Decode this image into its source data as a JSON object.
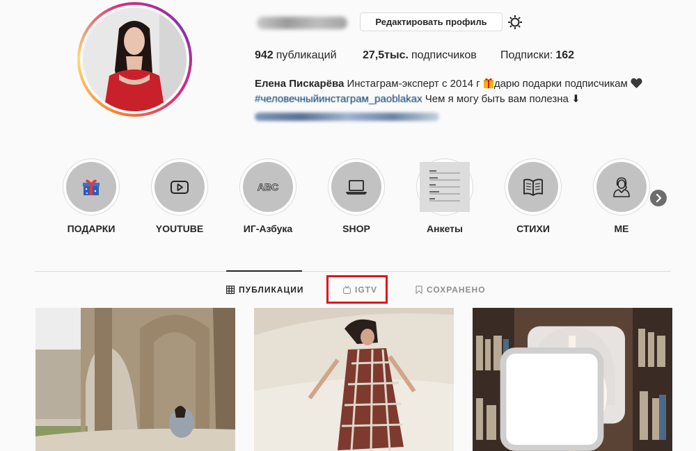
{
  "profile": {
    "edit_button": "Редактировать профиль",
    "stats": {
      "posts_count": "942",
      "posts_label": "публикаций",
      "followers_count": "27,5тыс.",
      "followers_label": "подписчиков",
      "following_label": "Подписки:",
      "following_count": "162"
    },
    "bio": {
      "name": "Елена Пискарёва",
      "text_1": " Инстаграм-эксперт с 2014 г ",
      "text_2": "дарю подарки подписчикам ",
      "hashtags": "#человечныйинстаграм_paoblakax",
      "text_3": " Чем я могу быть вам полезна ⬇"
    }
  },
  "highlights": [
    {
      "label": "ПОДАРКИ",
      "icon": "gift-icon"
    },
    {
      "label": "YOUTUBE",
      "icon": "youtube-play-icon"
    },
    {
      "label": "ИГ-Азбука",
      "icon": "abc-icon"
    },
    {
      "label": "SHOP",
      "icon": "laptop-icon"
    },
    {
      "label": "Анкеты",
      "icon": "form-sheet-icon"
    },
    {
      "label": "СТИХИ",
      "icon": "open-book-icon"
    },
    {
      "label": "ME",
      "icon": "woman-icon"
    }
  ],
  "tabs": [
    {
      "label": "ПУБЛИКАЦИИ",
      "icon": "grid-icon",
      "active": true
    },
    {
      "label": "IGTV",
      "icon": "igtv-icon",
      "active": false
    },
    {
      "label": "СОХРАНЕНО",
      "icon": "bookmark-icon",
      "active": false
    }
  ],
  "colors": {
    "text": "#262626",
    "muted": "#8e8e8e",
    "border": "#dbdbdb",
    "highlight_box": "#e0131b",
    "hashtag": "#00376b",
    "story_circle": "#c2c2c2"
  }
}
